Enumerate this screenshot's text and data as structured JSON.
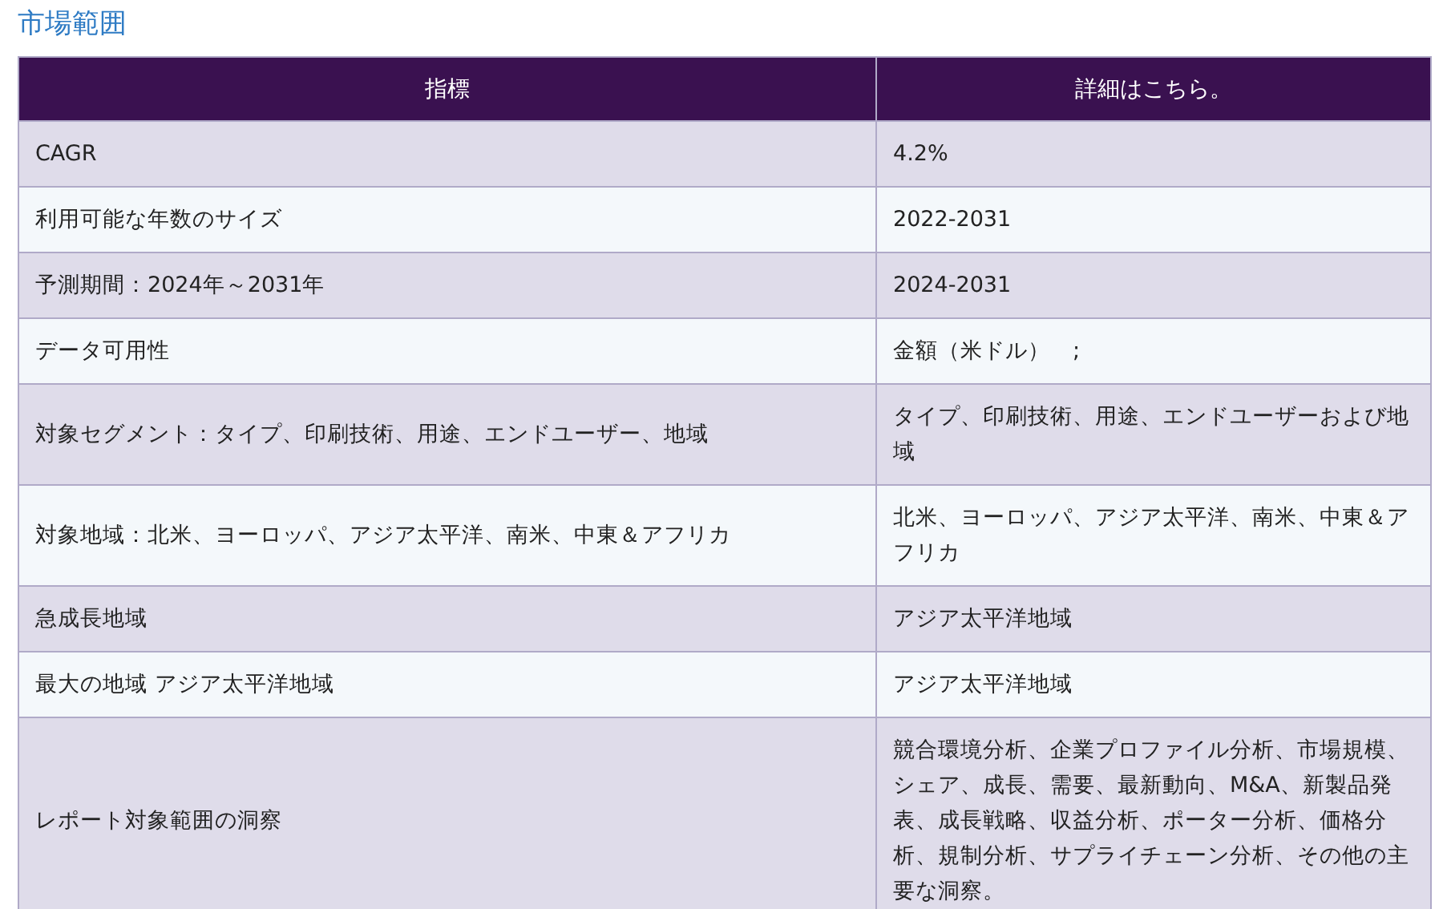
{
  "title": "市場範囲",
  "table": {
    "columns": [
      "指標",
      "詳細はこちら。"
    ],
    "rows": [
      [
        "CAGR",
        "4.2%"
      ],
      [
        "利用可能な年数のサイズ",
        "2022-2031"
      ],
      [
        "予測期間：2024年～2031年",
        "2024-2031"
      ],
      [
        "データ可用性",
        "金額（米ドル）　;"
      ],
      [
        "対象セグメント：タイプ、印刷技術、用途、エンドユーザー、地域",
        "タイプ、印刷技術、用途、エンドユーザーおよび地域"
      ],
      [
        "対象地域：北米、ヨーロッパ、アジア太平洋、南米、中東＆アフリカ",
        "北米、ヨーロッパ、アジア太平洋、南米、中東＆アフリカ"
      ],
      [
        "急成長地域",
        "アジア太平洋地域"
      ],
      [
        "最大の地域 アジア太平洋地域",
        "アジア太平洋地域"
      ],
      [
        "レポート対象範囲の洞察",
        "競合環境分析、企業プロファイル分析、市場規模、シェア、成長、需要、最新動向、M&A、新製品発表、成長戦略、収益分析、ポーター分析、価格分析、規制分析、サプライチェーン分析、その他の主要な洞察。"
      ]
    ]
  }
}
